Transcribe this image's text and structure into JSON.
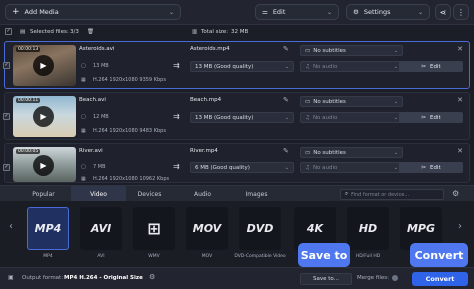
{
  "toolbar": {
    "add_media": "Add Media",
    "edit": "Edit",
    "settings": "Settings"
  },
  "summary": {
    "selected_label": "Selected files:",
    "selected_value": "3/3",
    "total_label": "Total size:",
    "total_value": "32 MB"
  },
  "files": [
    {
      "duration": "00:00:13",
      "source_name": "Asteroids.avi",
      "source_size": "13 MB",
      "source_info": "H.264 1920x1080 9359 Kbps",
      "output_name": "Asteroids.mp4",
      "quality": "13 MB (Good quality)",
      "subtitles": "No subtitles",
      "audio": "No audio",
      "edit": "Edit"
    },
    {
      "duration": "00:00:11",
      "source_name": "Beach.avi",
      "source_size": "12 MB",
      "source_info": "H.264 1920x1080 9483 Kbps",
      "output_name": "Beach.mp4",
      "quality": "13 MB (Good quality)",
      "subtitles": "No subtitles",
      "audio": "No audio",
      "edit": "Edit"
    },
    {
      "duration": "00:00:05",
      "source_name": "River.avi",
      "source_size": "7 MB",
      "source_info": "H.264 1920x1080 10962 Kbps",
      "output_name": "River.mp4",
      "quality": "6 MB (Good quality)",
      "subtitles": "No subtitles",
      "audio": "No audio",
      "edit": "Edit"
    }
  ],
  "tabs": [
    "Popular",
    "Video",
    "Devices",
    "Audio",
    "Images"
  ],
  "active_tab": "Video",
  "search_placeholder": "Find format or device...",
  "formats": [
    {
      "logo": "MP4",
      "label": "MP4"
    },
    {
      "logo": "AVI",
      "label": "AVI"
    },
    {
      "logo": "WMV",
      "label": "WMV"
    },
    {
      "logo": "MOV",
      "label": "MOV"
    },
    {
      "logo": "DVD",
      "label": "DVD-Compatible Video"
    },
    {
      "logo": "4K",
      "label": "4K Ultra HD"
    },
    {
      "logo": "HD",
      "label": "HD/Full HD"
    },
    {
      "logo": "MPG",
      "label": "MPG"
    }
  ],
  "bottom": {
    "output_label": "Output format:",
    "output_value": "MP4 H.264 - Original Size",
    "save_to": "Save to...",
    "merge": "Merge files:",
    "convert": "Convert"
  },
  "callouts": {
    "save_to": "Save to",
    "convert": "Convert"
  },
  "colors": {
    "accent": "#2f63e8",
    "callout": "#4f78f0"
  }
}
